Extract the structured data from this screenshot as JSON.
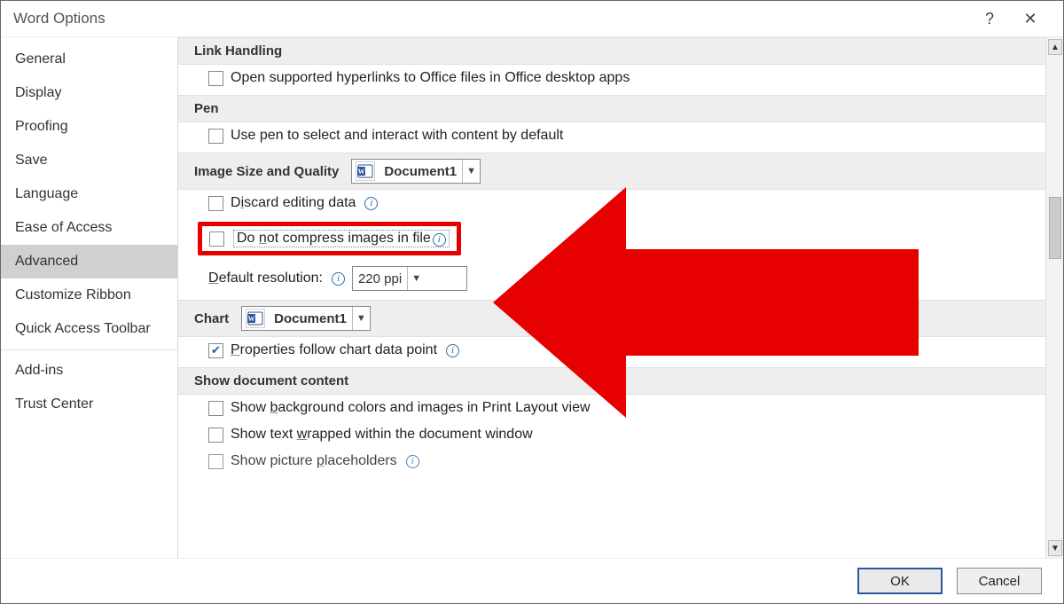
{
  "title": "Word Options",
  "sidebar": {
    "items": [
      {
        "label": "General"
      },
      {
        "label": "Display"
      },
      {
        "label": "Proofing"
      },
      {
        "label": "Save"
      },
      {
        "label": "Language"
      },
      {
        "label": "Ease of Access"
      },
      {
        "label": "Advanced"
      },
      {
        "label": "Customize Ribbon"
      },
      {
        "label": "Quick Access Toolbar"
      },
      {
        "label": "Add-ins"
      },
      {
        "label": "Trust Center"
      }
    ],
    "selected": "Advanced"
  },
  "sections": {
    "linkHandling": {
      "title": "Link Handling",
      "openHyperlinks": "Open supported hyperlinks to Office files in Office desktop apps"
    },
    "pen": {
      "title": "Pen",
      "usePen": "Use pen to select and interact with content by default"
    },
    "imageSizeQuality": {
      "title": "Image Size and Quality",
      "docCombo": "Document1",
      "discard": "Discard editing data",
      "doNotCompress": "Do not compress images in file",
      "defaultResLabel": "Default resolution:",
      "defaultResValue": "220 ppi"
    },
    "chart": {
      "title": "Chart",
      "docCombo": "Document1",
      "propsFollow": "Properties follow chart data point"
    },
    "showDocContent": {
      "title": "Show document content",
      "bgColors": "Show background colors and images in Print Layout view",
      "textWrapped": "Show text wrapped within the document window",
      "picturePlaceholders": "Show picture placeholders"
    }
  },
  "buttons": {
    "ok": "OK",
    "cancel": "Cancel"
  },
  "highlight_color": "#e60000"
}
